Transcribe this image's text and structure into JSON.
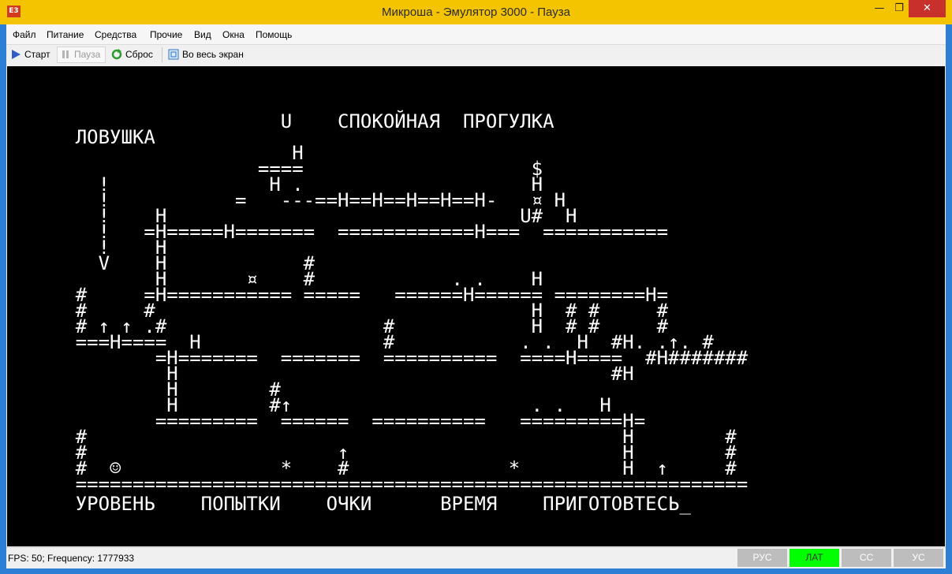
{
  "window": {
    "title": "Микроша - Эмулятор 3000 - Пауза",
    "app_icon": "E3",
    "controls": {
      "minimize": "—",
      "maximize": "❐",
      "close": "✕"
    }
  },
  "menu": [
    "Файл",
    "Питание",
    "Средства",
    "Прочие",
    "Вид",
    "Окна",
    "Помощь"
  ],
  "toolbar": {
    "start": {
      "label": "Старт",
      "icon": "play-icon"
    },
    "pause": {
      "label": "Пауза",
      "icon": "pause-icon",
      "disabled": true
    },
    "reset": {
      "label": "Сброс",
      "icon": "reset-icon"
    },
    "fullscreen": {
      "label": "Во весь экран",
      "icon": "fullscreen-icon"
    }
  },
  "screen": {
    "rows": [
      "",
      "",
      "",
      "",
      "                        U    СПОКОЙНАЯ  ПРОГУЛКА",
      "      ЛОВУШКА",
      "                         H",
      "                      ====                    $",
      "        !              H .                    H",
      "        !           =   ---==H==H==H==H==H-   ¤ H",
      "        !    H                               U#  H",
      "        !   =H=====H=======  ============H===  ===========",
      "        !    H",
      "        V    H            #",
      "             H       ¤    #            . .    H",
      "      #     =H=========== =====   ======H====== ========H=",
      "      #     #                                 H  # #     #",
      "      # ↑ ↑ .#                   #            H  # #     #",
      "      ===H====  H                #           . .  H  #H. .↑. #",
      "             =H=======  =======  ==========  ====H====  #H#######",
      "              H                                      #H",
      "              H        #",
      "              H        #↑                     . .   H",
      "             =========  ======  ==========   =========H=",
      "      #                                               H        #",
      "      #                      ↑                        H        #",
      "      #  ☺              *    #              *         H  ↑     #",
      "      ===========================================================",
      "      УРОВЕНЬ    ПОПЫТКИ    ОЧКИ      ВРЕМЯ    ПРИГОТОВТЕСЬ_"
    ]
  },
  "status": {
    "text": "FPS: 50; Frequency: 1777933",
    "indicators": [
      {
        "label": "РУС",
        "active": false
      },
      {
        "label": "ЛАТ",
        "active": true
      },
      {
        "label": "СС",
        "active": false
      },
      {
        "label": "УС",
        "active": false
      }
    ],
    "colors": {
      "active": "#00ff00",
      "inactive": "#bdbdbd"
    }
  }
}
